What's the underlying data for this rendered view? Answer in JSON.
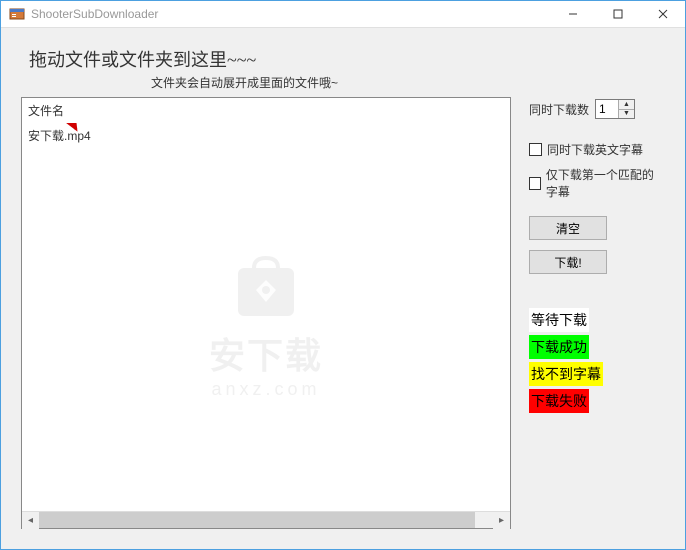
{
  "window": {
    "title": "ShooterSubDownloader"
  },
  "header": {
    "main": "拖动文件或文件夹到这里~~~",
    "sub": "文件夹会自动展开成里面的文件哦~"
  },
  "list": {
    "column_header": "文件名",
    "items": [
      "安下载.mp4"
    ]
  },
  "side": {
    "concurrent_label": "同时下载数",
    "concurrent_value": "1",
    "checkbox_eng": "同时下载英文字幕",
    "checkbox_first": "仅下载第一个匹配的字幕",
    "btn_clear": "清空",
    "btn_download": "下载!"
  },
  "status": {
    "waiting": {
      "text": "等待下载",
      "bg": "#ffffff",
      "color": "#000000"
    },
    "success": {
      "text": "下载成功",
      "bg": "#00ff00",
      "color": "#000000"
    },
    "notfound": {
      "text": "找不到字幕",
      "bg": "#ffff00",
      "color": "#000000"
    },
    "failed": {
      "text": "下载失败",
      "bg": "#ff0000",
      "color": "#000000"
    }
  },
  "watermark": {
    "text": "安下载",
    "sub": "anxz.com"
  }
}
